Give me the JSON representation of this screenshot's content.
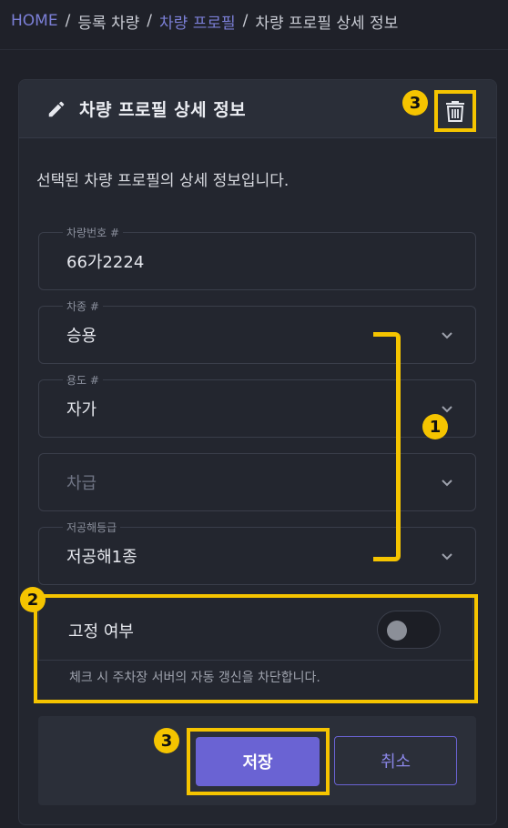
{
  "breadcrumb": {
    "home": "HOME",
    "sep1": "/",
    "registered": "등록 차량",
    "sep2": "/",
    "profile": "차량 프로필",
    "sep3": "/",
    "current": "차량 프로필 상세 정보"
  },
  "card": {
    "title": "차량 프로필 상세 정보",
    "description": "선택된 차량 프로필의 상세 정보입니다."
  },
  "fields": [
    {
      "label": "차량번호 #",
      "value": "66가2224",
      "type": "text"
    },
    {
      "label": "차종 #",
      "value": "승용",
      "type": "select"
    },
    {
      "label": "용도 #",
      "value": "자가",
      "type": "select"
    },
    {
      "label": "",
      "value": "차급",
      "type": "select",
      "placeholder": true
    },
    {
      "label": "저공해등급",
      "value": "저공해1종",
      "type": "select"
    }
  ],
  "toggle": {
    "label": "고정 여부",
    "help": "체크 시 주차장 서버의 자동 갱신을 차단합니다.",
    "checked": false
  },
  "buttons": {
    "save": "저장",
    "cancel": "취소"
  },
  "annotations": {
    "badge_trash": "3",
    "badge_fields": "1",
    "badge_toggle": "2",
    "badge_save": "3"
  },
  "colors": {
    "accent": "#6a63d3",
    "highlight": "#f5c400",
    "background": "#1f2129"
  }
}
